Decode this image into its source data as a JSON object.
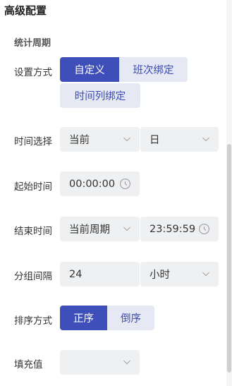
{
  "header": {
    "title": "高级配置"
  },
  "section": {
    "title": "统计周期"
  },
  "setting_mode": {
    "label": "设置方式",
    "options": [
      "自定义",
      "班次绑定",
      "时间列绑定"
    ],
    "selected": "自定义"
  },
  "time_select": {
    "label": "时间选择",
    "first_value": "当前",
    "second_value": "日"
  },
  "start_time": {
    "label": "起始时间",
    "value": "00:00:00"
  },
  "end_time": {
    "label": "结束时间",
    "period_value": "当前周期",
    "time_value": "23:59:59"
  },
  "group_interval": {
    "label": "分组间隔",
    "value": "24",
    "unit_value": "小时"
  },
  "sort_mode": {
    "label": "排序方式",
    "options": [
      "正序",
      "倒序"
    ],
    "selected": "正序"
  },
  "fill_value": {
    "label": "填充值",
    "value": ""
  },
  "colors": {
    "accent": "#3e4fb9",
    "inactive_bg": "#e6e9f3",
    "field_bg": "#eff0f2"
  },
  "icons": {
    "dropdown": "chevron-down-icon",
    "time": "clock-icon"
  }
}
